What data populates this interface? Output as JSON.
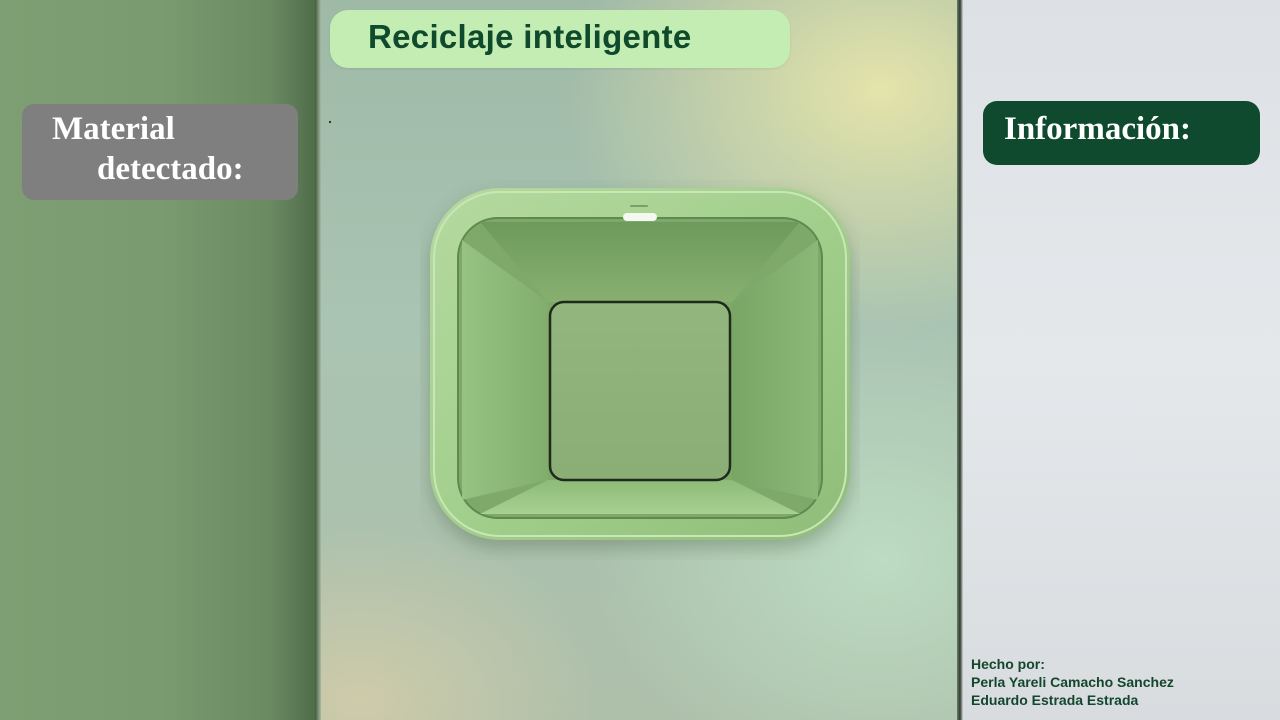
{
  "app": {
    "title": "Reciclaje inteligente"
  },
  "material_panel": {
    "label_line1": "Material",
    "label_line2": "detectado:"
  },
  "info_panel": {
    "label": "Información:"
  },
  "credits": {
    "heading": "Hecho por:",
    "authors": [
      "Perla Yareli Camacho Sanchez",
      "Eduardo Estrada Estrada"
    ]
  },
  "colors": {
    "title_banner_bg": "#c4edb4",
    "title_text": "#0f4a2c",
    "material_box_bg": "#7f7f7f",
    "info_box_bg": "#0f4a2e",
    "bin_green": "#9cc98a"
  },
  "illustration": {
    "icon": "recycling-bin-top-view-icon"
  }
}
